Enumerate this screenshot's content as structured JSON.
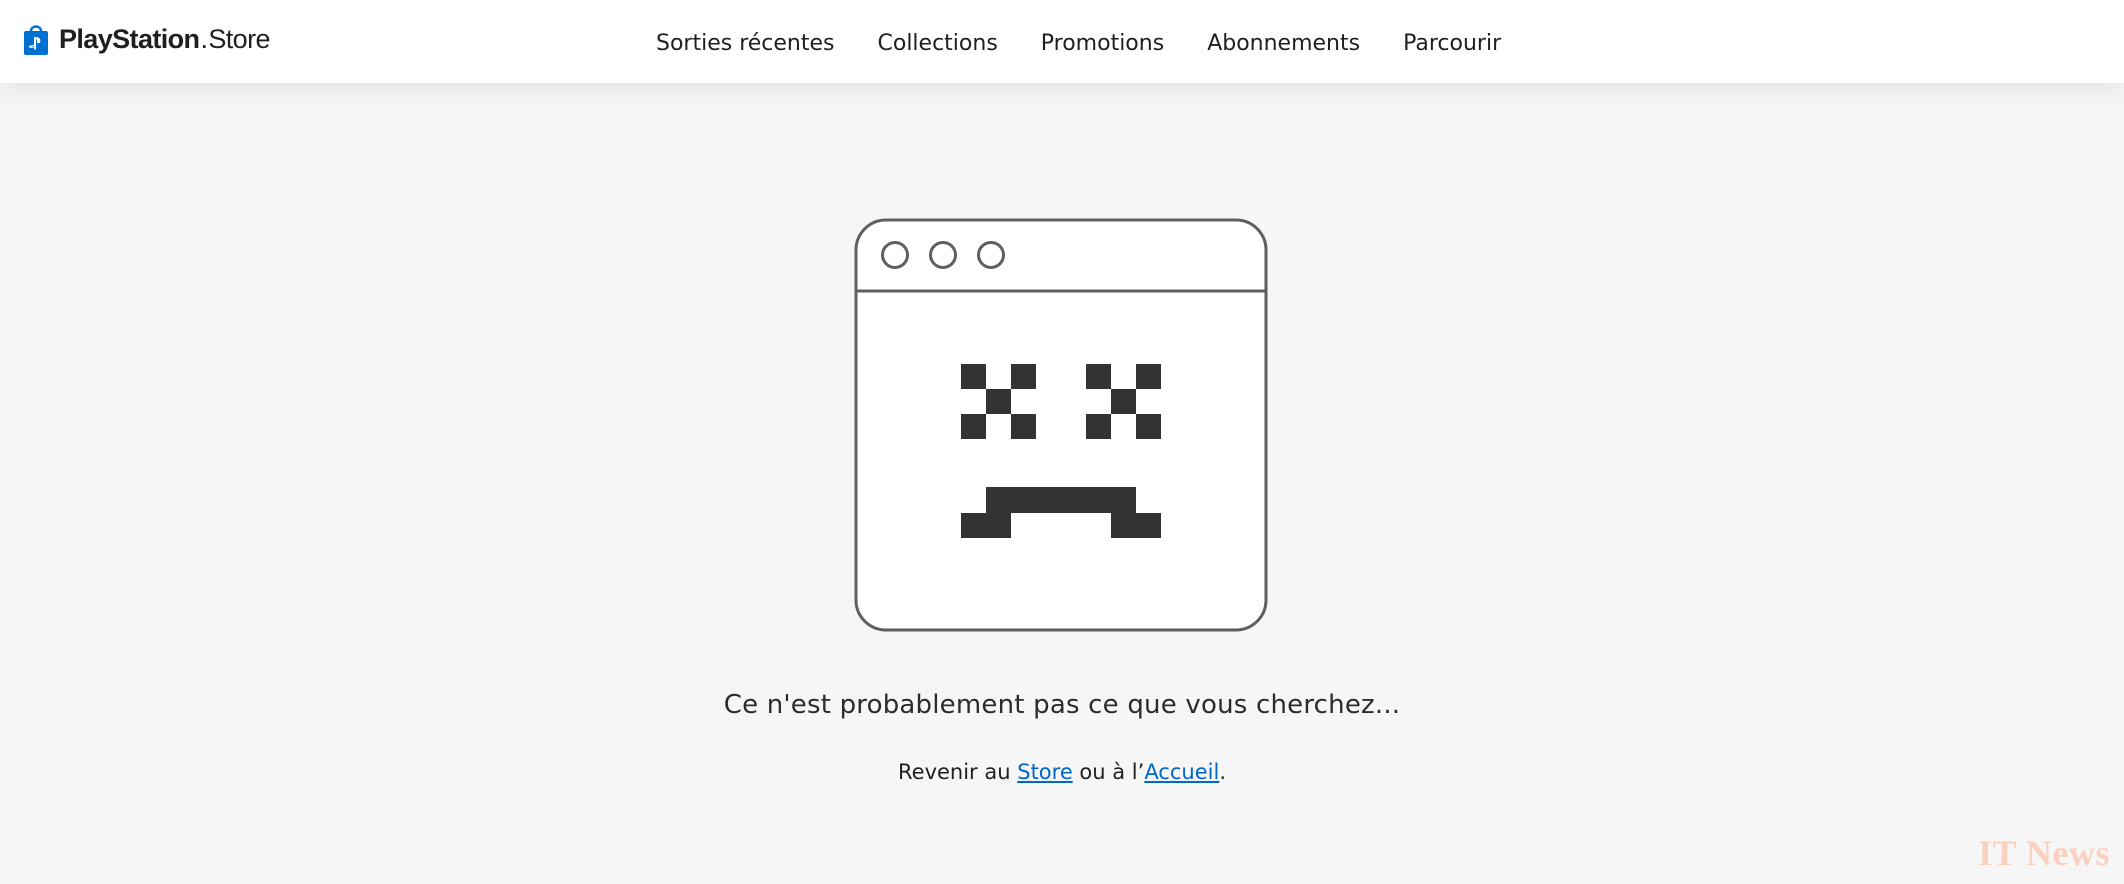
{
  "header": {
    "logo": {
      "brand": "PlayStation",
      "separator": ".",
      "product": "Store",
      "icon": "playstation-store-bag-icon",
      "color": "#0070d1"
    },
    "nav": [
      {
        "label": "Sorties récentes"
      },
      {
        "label": "Collections"
      },
      {
        "label": "Promotions"
      },
      {
        "label": "Abonnements"
      },
      {
        "label": "Parcourir"
      }
    ]
  },
  "error": {
    "illustration_icon": "sad-browser-window-icon",
    "message": "Ce n'est probablement pas ce que vous cherchez...",
    "links": {
      "prefix": "Revenir au ",
      "store_label": "Store",
      "middle": " ou à l’",
      "home_label": "Accueil",
      "suffix": "."
    }
  },
  "watermark": "IT News",
  "colors": {
    "link": "#0068c8",
    "illustration_stroke": "#5f5f5f",
    "illustration_fill": "#333333",
    "watermark": "#f9d1be"
  }
}
